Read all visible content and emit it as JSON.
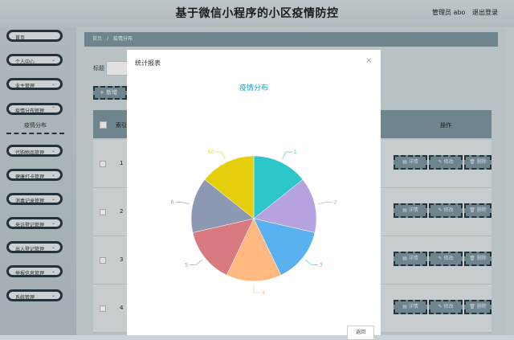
{
  "header": {
    "title": "基于微信小程序的小区疫情防控",
    "user": "管理员 abo",
    "logout": "退出登录"
  },
  "sidebar": {
    "items": [
      {
        "label": "首页"
      },
      {
        "label": "个人中心"
      },
      {
        "label": "业主管理"
      },
      {
        "label": "疫情分布管理"
      },
      {
        "label": "代购物品管理"
      },
      {
        "label": "健康打卡管理"
      },
      {
        "label": "消毒记录管理"
      },
      {
        "label": "来访登记管理"
      },
      {
        "label": "出入登记管理"
      },
      {
        "label": "举报信息管理"
      },
      {
        "label": "系统管理"
      }
    ],
    "submenu": "疫情分布"
  },
  "breadcrumb": {
    "home": "首页",
    "sep": "/",
    "current": "疫情分布"
  },
  "search": {
    "label": "标题"
  },
  "toolbar": {
    "add": "+ 新增"
  },
  "table": {
    "header_index": "索引",
    "header_ops": "操作",
    "rows": [
      "1",
      "2",
      "3",
      "4"
    ],
    "actions": {
      "detail": "详情",
      "edit": "修改",
      "delete": "删除"
    }
  },
  "dialog": {
    "title": "统计报表",
    "close": "×",
    "chart_title": "疫情分布",
    "back": "返回"
  },
  "chart_data": {
    "type": "pie",
    "title": "疫情分布",
    "categories": [
      "1",
      "2",
      "3",
      "4",
      "5",
      "6",
      "50"
    ],
    "values": [
      1,
      1,
      1,
      1,
      1,
      1,
      1
    ],
    "colors": [
      "#2ec7c9",
      "#b6a2de",
      "#5ab1ef",
      "#ffb980",
      "#d87a80",
      "#8d98b3",
      "#e5cf0d"
    ]
  }
}
